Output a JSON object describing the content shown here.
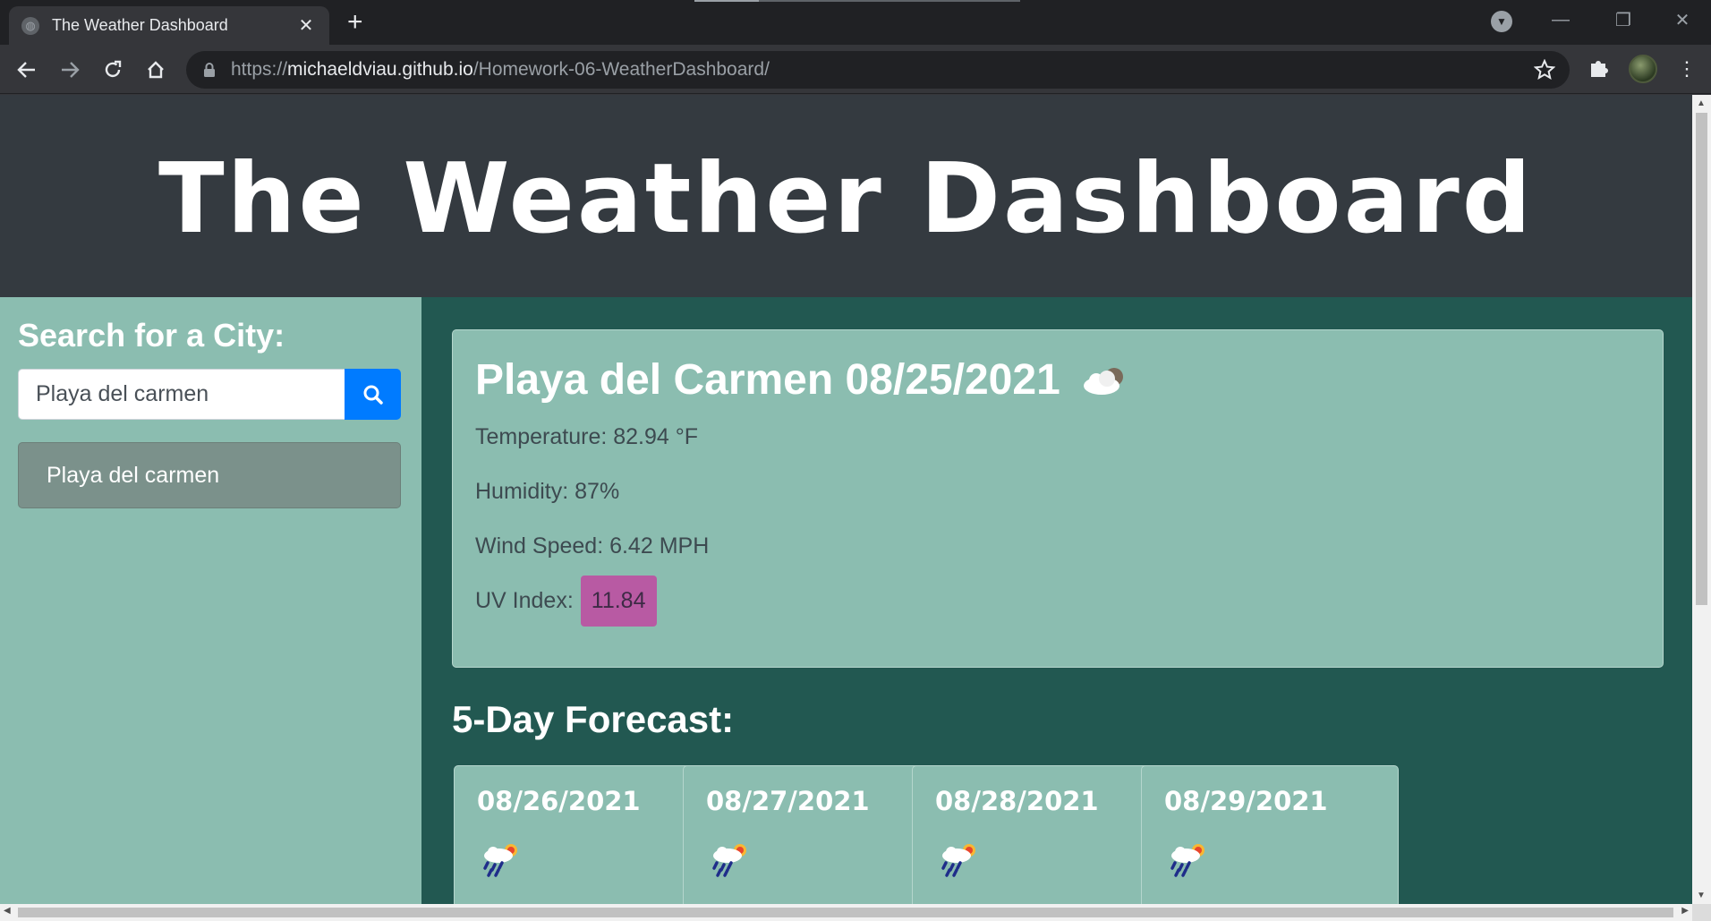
{
  "browser": {
    "tab_title": "The Weather Dashboard",
    "url_scheme": "https://",
    "url_host": "michaeldviau.github.io",
    "url_path": "/Homework-06-WeatherDashboard/"
  },
  "header": {
    "title": "The Weather Dashboard"
  },
  "sidebar": {
    "heading": "Search for a City:",
    "search_value": "Playa del carmen",
    "history": [
      "Playa del carmen"
    ]
  },
  "current": {
    "title": "Playa del Carmen 08/25/2021",
    "icon": "partly-cloudy-icon",
    "temperature": "Temperature: 82.94 °F",
    "humidity": "Humidity: 87%",
    "wind": "Wind Speed: 6.42 MPH",
    "uv_label": "UV Index:",
    "uv_value": "11.84",
    "uv_color": "#b85aa3"
  },
  "forecast": {
    "heading": "5-Day Forecast:",
    "days": [
      {
        "date": "08/26/2021",
        "icon": "rain-sun-icon"
      },
      {
        "date": "08/27/2021",
        "icon": "rain-sun-icon"
      },
      {
        "date": "08/28/2021",
        "icon": "rain-sun-icon"
      },
      {
        "date": "08/29/2021",
        "icon": "rain-sun-icon"
      }
    ]
  },
  "colors": {
    "header_bg": "#343a40",
    "sidebar_bg": "#8bbdb0",
    "main_bg": "#225851",
    "search_button": "#007bff"
  }
}
